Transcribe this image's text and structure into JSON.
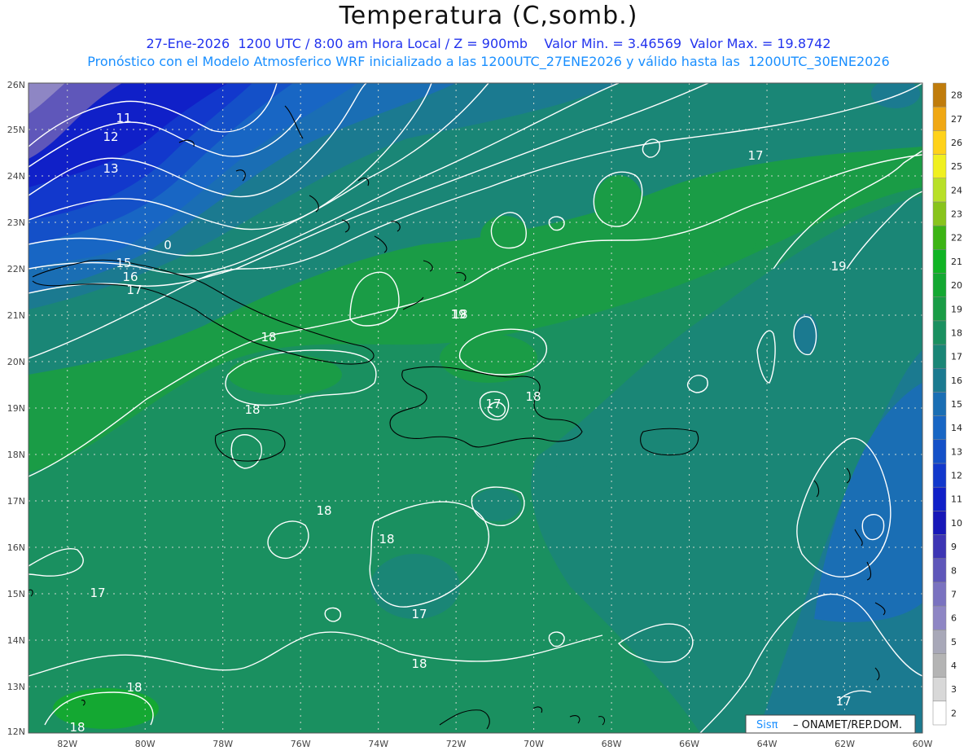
{
  "header": {
    "title": "Temperatura (C,somb.)",
    "subtitle_line1": "27-Ene-2026  1200 UTC / 8:00 am Hora Local / Z = 900mb    Valor Min. = 3.46569  Valor Max. = 19.8742",
    "subtitle_line2": "Pronóstico con el Modelo Atmosferico WRF inicializado a las 1200UTC_27ENE2026 y válido hasta las  1200UTC_30ENE2026"
  },
  "colors": {
    "bg_green_dark": "#1f8b5a",
    "bg_green": "#1a9e4a",
    "bg_teal": "#1b7d76",
    "bg_blue": "#1560b8",
    "bg_deepblue": "#1a2fc0",
    "bg_purple": "#8f86c6",
    "contour": "#ffffff",
    "coast": "#000000",
    "grid": "#cfd8cf"
  },
  "axes": {
    "lon_labels": [
      "82W",
      "80W",
      "78W",
      "76W",
      "74W",
      "72W",
      "70W",
      "68W",
      "66W",
      "64W",
      "62W",
      "60W"
    ],
    "lat_labels": [
      "26N",
      "25N",
      "24N",
      "23N",
      "22N",
      "21N",
      "20N",
      "19N",
      "18N",
      "17N",
      "16N",
      "15N",
      "14N",
      "13N",
      "12N"
    ]
  },
  "colorbar": {
    "levels": [
      "2",
      "3",
      "4",
      "5",
      "6",
      "7",
      "8",
      "9",
      "10",
      "11",
      "12",
      "13",
      "14",
      "15",
      "16",
      "17",
      "18",
      "19",
      "20",
      "21",
      "22",
      "23",
      "24",
      "25",
      "26",
      "27",
      "28"
    ],
    "colors": [
      "#ffffff",
      "#d8d8d8",
      "#b4b4b4",
      "#a8a8b8",
      "#8e86c4",
      "#7a72c0",
      "#5f57ba",
      "#3d35b4",
      "#1818b8",
      "#1020c8",
      "#1238cc",
      "#1450c8",
      "#1866c4",
      "#1a6eb4",
      "#1b7a90",
      "#1a8676",
      "#1a9060",
      "#1a9c46",
      "#14a832",
      "#10b424",
      "#3cb414",
      "#88c41c",
      "#b8e028",
      "#f0f020",
      "#ffd21a",
      "#f0a814",
      "#c07c0c"
    ]
  },
  "contour_labels": [
    "11",
    "12",
    "13",
    "0",
    "15",
    "16",
    "17",
    "18",
    "19",
    "18",
    "18",
    "18",
    "18",
    "17",
    "17",
    "18",
    "18",
    "18",
    "19",
    "17",
    "17",
    "18",
    "17"
  ],
  "footer": {
    "sis_logo": "Sisπ",
    "credit": "– ONAMET/REP.DOM."
  }
}
